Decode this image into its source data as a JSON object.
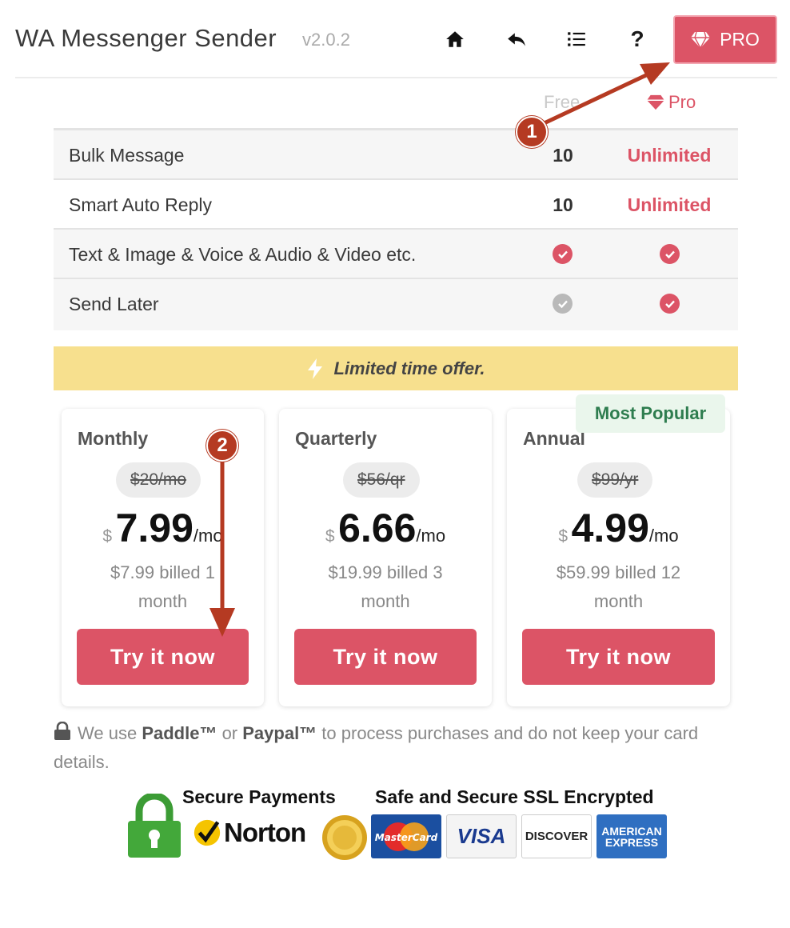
{
  "header": {
    "title": "WA Messenger Sender",
    "version": "v2.0.2",
    "pro_label": "PRO"
  },
  "columns": {
    "free": "Free",
    "pro": "Pro"
  },
  "features": [
    {
      "label": "Bulk Message",
      "free": "10",
      "pro": "Unlimited"
    },
    {
      "label": "Smart Auto Reply",
      "free": "10",
      "pro": "Unlimited"
    },
    {
      "label": "Text & Image & Voice & Audio & Video etc.",
      "free": "check-red",
      "pro": "check-red"
    },
    {
      "label": "Send Later",
      "free": "check-gray",
      "pro": "check-red"
    }
  ],
  "offer": {
    "text": "Limited time offer."
  },
  "badge": "Most Popular",
  "plans": [
    {
      "name": "Monthly",
      "old_price": "$20/mo",
      "currency": "$",
      "amount": "7.99",
      "per": "/mo",
      "billed_line1": "$7.99 billed 1",
      "billed_line2": "month",
      "button": "Try it now"
    },
    {
      "name": "Quarterly",
      "old_price": "$56/qr",
      "currency": "$",
      "amount": "6.66",
      "per": "/mo",
      "billed_line1": "$19.99 billed 3",
      "billed_line2": "month",
      "button": "Try it now"
    },
    {
      "name": "Annual",
      "old_price": "$99/yr",
      "currency": "$",
      "amount": "4.99",
      "per": "/mo",
      "billed_line1": "$59.99 billed 12",
      "billed_line2": "month",
      "button": "Try it now"
    }
  ],
  "note": {
    "prefix": "We use ",
    "paddle": "Paddle™",
    "or": " or ",
    "paypal": "Paypal™",
    "suffix": " to process purchases and do not keep your card details."
  },
  "trust": {
    "secure_payments": "Secure Payments",
    "ssl": "Safe and Secure SSL Encrypted",
    "norton": "Norton",
    "mastercard": "MasterCard",
    "visa": "VISA",
    "discover": "DISCOVER",
    "amex_line1": "AMERICAN",
    "amex_line2": "EXPRESS"
  },
  "annotations": {
    "step1": "1",
    "step2": "2"
  },
  "colors": {
    "accent": "#dc5466",
    "offer": "#f7e08e",
    "badge_text": "#2e7d4f",
    "annotation": "#b53a22"
  },
  "icons": [
    "home-icon",
    "undo-icon",
    "list-icon",
    "help-icon",
    "diamond-icon",
    "bolt-icon",
    "lock-icon",
    "check-icon"
  ]
}
